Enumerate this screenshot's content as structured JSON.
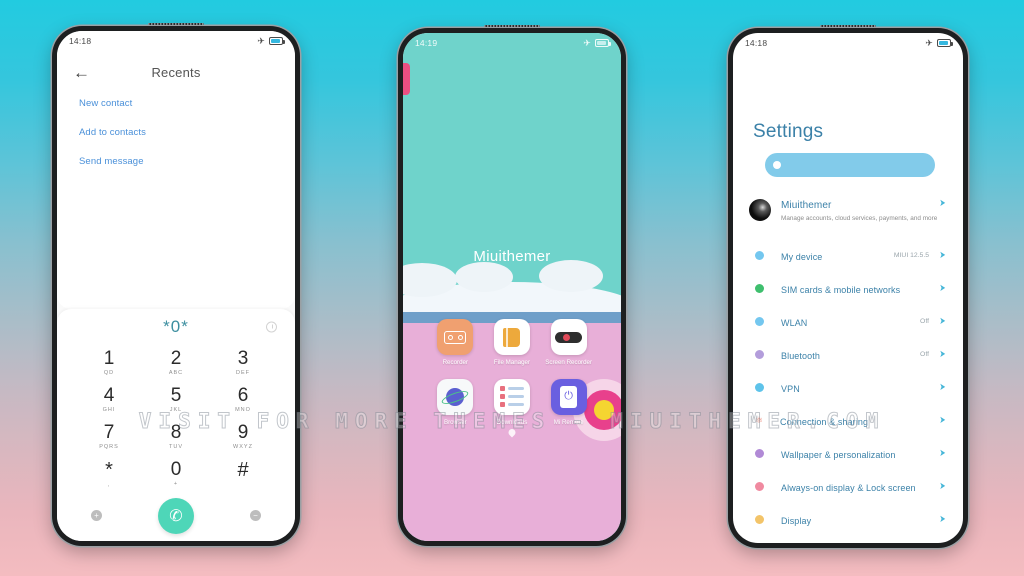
{
  "background": {
    "top_color": "#22cbe0",
    "bottom_color": "#f4bcc0"
  },
  "watermark": {
    "text": "VISIT FOR MORE THEMES - MIUITHEMER.COM"
  },
  "phone_left": {
    "statusbar": {
      "time": "14:18",
      "airplane_icon": "airplane-icon",
      "battery_icon": "battery-icon"
    },
    "recents": {
      "back_icon": "back-arrow-icon",
      "title": "Recents",
      "links": [
        {
          "label": "New contact"
        },
        {
          "label": "Add to contacts"
        },
        {
          "label": "Send message"
        }
      ]
    },
    "dialer": {
      "number": "*0*",
      "history_icon": "call-history-icon",
      "keys": [
        {
          "digit": "1",
          "letters": "QD"
        },
        {
          "digit": "2",
          "letters": "ABC"
        },
        {
          "digit": "3",
          "letters": "DEF"
        },
        {
          "digit": "4",
          "letters": "GHI"
        },
        {
          "digit": "5",
          "letters": "JKL"
        },
        {
          "digit": "6",
          "letters": "MNO"
        },
        {
          "digit": "7",
          "letters": "PQRS"
        },
        {
          "digit": "8",
          "letters": "TUV"
        },
        {
          "digit": "9",
          "letters": "WXYZ"
        },
        {
          "digit": "*",
          "letters": ","
        },
        {
          "digit": "0",
          "letters": "+"
        },
        {
          "digit": "#",
          "letters": ""
        }
      ],
      "add_icon": "add-contact-icon",
      "call_icon": "call-icon",
      "remove_icon": "remove-icon",
      "call_button_color": "#4ed6b8"
    }
  },
  "phone_middle": {
    "statusbar": {
      "time": "14:19",
      "airplane_icon": "airplane-icon",
      "battery_icon": "battery-icon"
    },
    "home": {
      "wallpaper_top_color": "#6fd3cb",
      "wallpaper_bottom_color": "#e8afd8",
      "label": "Miuithemer",
      "apps": [
        {
          "name": "Recorder",
          "icon": "recorder-icon"
        },
        {
          "name": "File Manager",
          "icon": "file-manager-icon"
        },
        {
          "name": "Screen Recorder",
          "icon": "screen-recorder-icon"
        },
        {
          "name": "Browser",
          "icon": "browser-icon"
        },
        {
          "name": "Downloads",
          "icon": "downloads-icon"
        },
        {
          "name": "Mi Remote",
          "icon": "mi-remote-icon"
        }
      ]
    }
  },
  "phone_right": {
    "statusbar": {
      "time": "14:18",
      "airplane_icon": "airplane-icon",
      "battery_icon": "battery-icon"
    },
    "settings": {
      "title": "Settings",
      "search_placeholder": "",
      "account": {
        "name": "Miuithemer",
        "subtitle": "Manage accounts, cloud services, payments, and more"
      },
      "items": [
        {
          "label": "My device",
          "value": "MIUI 12.5.5",
          "dot": "#74c7ef"
        },
        {
          "label": "SIM cards & mobile networks",
          "value": "",
          "dot": "#3fbf6e"
        },
        {
          "label": "WLAN",
          "value": "Off",
          "dot": "#74c7ef"
        },
        {
          "label": "Bluetooth",
          "value": "Off",
          "dot": "#b39ddb"
        },
        {
          "label": "VPN",
          "value": "",
          "dot": "#5ec3ea"
        },
        {
          "label": "Connection & sharing",
          "value": "",
          "dot": "#e4604a"
        },
        {
          "label": "Wallpaper & personalization",
          "value": "",
          "dot": "#b18ad6"
        },
        {
          "label": "Always-on display & Lock screen",
          "value": "",
          "dot": "#f08aa0"
        },
        {
          "label": "Display",
          "value": "",
          "dot": "#f3c469"
        }
      ]
    }
  }
}
